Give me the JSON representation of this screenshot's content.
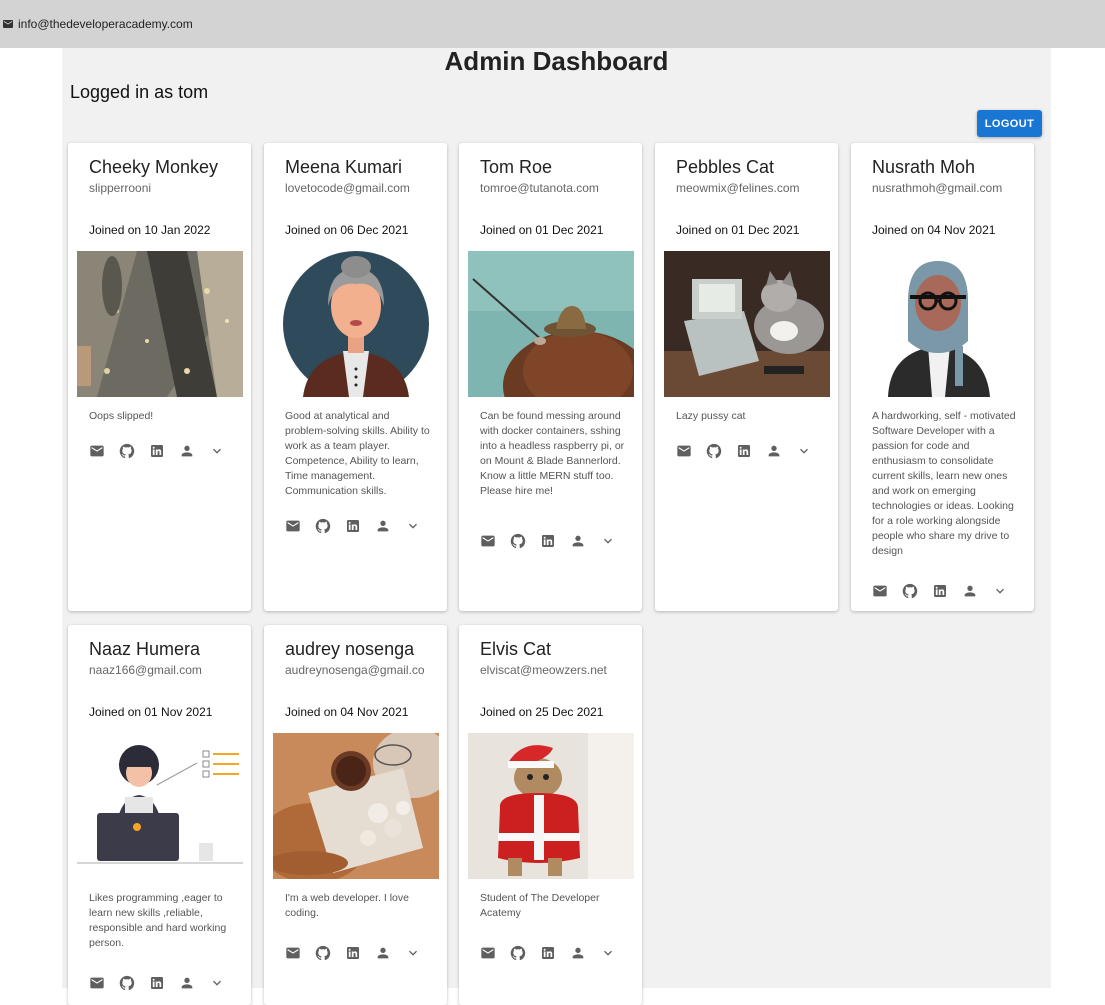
{
  "topbar": {
    "email": "info@thedeveloperacademy.com"
  },
  "header": {
    "title": "Admin Dashboard",
    "logged_in": "Logged in as tom",
    "logout_label": "LOGOUT"
  },
  "cards": [
    {
      "name": "Cheeky Monkey",
      "email": "slipperrooni",
      "joined": "Joined on 10 Jan 2022",
      "bio": "Oops slipped!",
      "photo": "wet-sidewalk-photo"
    },
    {
      "name": "Meena Kumari",
      "email": "lovetocode@gmail.com",
      "joined": "Joined on 06 Dec 2021",
      "bio": "Good at analytical and problem-solving skills. Ability to work as a team player. Competence, Ability to learn, Time management. Communication skills.",
      "photo": "woman-avatar-illustration"
    },
    {
      "name": "Tom Roe",
      "email": "tomroe@tutanota.com",
      "joined": "Joined on 01 Dec 2021",
      "bio": "Can be found messing around with docker containers, sshing into a headless raspberry pi, or on Mount & Blade Bannerlord. Know a little MERN stuff too. Please hire me!",
      "photo": "dog-fishing-photo"
    },
    {
      "name": "Pebbles Cat",
      "email": "meowmix@felines.com",
      "joined": "Joined on 01 Dec 2021",
      "bio": "Lazy pussy cat",
      "photo": "cat-computer-photo"
    },
    {
      "name": "Nusrath Moh",
      "email": "nusrathmoh@gmail.com",
      "joined": "Joined on 04 Nov 2021",
      "bio": "A hardworking, self - motivated Software Developer with a passion for code and enthusiasm to consolidate current skills, learn new ones and work on emerging technologies or ideas. Looking for a role working alongside people who share my drive to design",
      "photo": "hijab-avatar-illustration"
    },
    {
      "name": "Naaz Humera",
      "email": "naaz166@gmail.com",
      "joined": "Joined on 01 Nov 2021",
      "bio": "Likes programming ,eager to learn new skills ,reliable, responsible and hard working person.",
      "photo": "laptop-girl-illustration"
    },
    {
      "name": "audrey nosenga",
      "email": "audreynosenga@gmail.co",
      "joined": "Joined on 04 Nov 2021",
      "bio": "I'm a web developer. I love coding.",
      "photo": "coffee-flowers-photo"
    },
    {
      "name": "Elvis Cat",
      "email": "elviscat@meowzers.net",
      "joined": "Joined on 25 Dec 2021",
      "bio": "Student of The Developer Acatemy",
      "photo": "santa-cat-photo"
    }
  ],
  "action_icons": [
    "email-icon",
    "github-icon",
    "linkedin-icon",
    "person-icon",
    "chevron-down-icon"
  ],
  "colors": {
    "topbar": "#d3d3d3",
    "background": "#f1f1f1",
    "accent": "#1976d2"
  }
}
